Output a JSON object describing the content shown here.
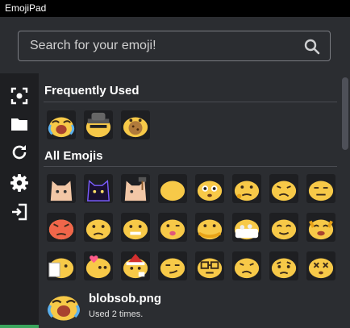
{
  "app": {
    "title": "EmojiPad"
  },
  "search": {
    "placeholder": "Search for your emoji!",
    "value": ""
  },
  "sidebar": {
    "items": [
      {
        "icon": "screenshot-icon"
      },
      {
        "icon": "folder-icon"
      },
      {
        "icon": "refresh-icon"
      },
      {
        "icon": "gear-icon"
      },
      {
        "icon": "sign-in-icon"
      }
    ],
    "accent_color": "#3ba55d"
  },
  "sections": {
    "frequently_used": "Frequently Used",
    "all_emojis": "All Emojis"
  },
  "footer": {
    "name": "blobsob.png",
    "usage": "Used 2 times."
  },
  "colors": {
    "blob": "#f7c948",
    "blob_dark": "#e8a317",
    "background": "#2b2d31",
    "sidebar": "#1e1f22"
  }
}
